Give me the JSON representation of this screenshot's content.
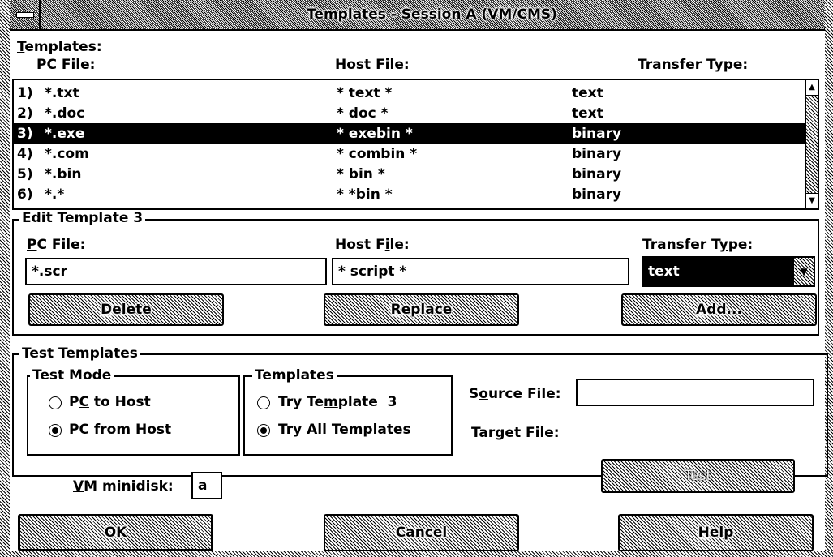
{
  "window": {
    "title": "Templates - Session A (VM/CMS)"
  },
  "templates_section": {
    "label": "Templates:",
    "col_pc": "PC File:",
    "col_host": "Host File:",
    "col_type": "Transfer Type:"
  },
  "template_rows": [
    {
      "num": "1)",
      "pc": "*.txt",
      "host": "* text *",
      "type": "text"
    },
    {
      "num": "2)",
      "pc": "*.doc",
      "host": "* doc *",
      "type": "text"
    },
    {
      "num": "3)",
      "pc": "*.exe",
      "host": "* exebin *",
      "type": "binary"
    },
    {
      "num": "4)",
      "pc": "*.com",
      "host": "* combin *",
      "type": "binary"
    },
    {
      "num": "5)",
      "pc": "*.bin",
      "host": "* bin *",
      "type": "binary"
    },
    {
      "num": "6)",
      "pc": "*.*",
      "host": "* *bin *",
      "type": "binary"
    }
  ],
  "selected_row_index": 2,
  "edit": {
    "label": "Edit Template  3",
    "pc_label": "PC File:",
    "host_label": "Host File:",
    "type_label": "Transfer Type:",
    "pc_value": "*.scr",
    "host_value": "* script *",
    "type_value": "text",
    "delete": "Delete",
    "replace": "Replace",
    "add": "Add..."
  },
  "test": {
    "label": "Test Templates",
    "mode_label": "Test Mode",
    "pc_to_host": "PC to Host",
    "pc_from_host": "PC from Host",
    "templates_label": "Templates",
    "try_template": "Try Template  3",
    "try_all": "Try All Templates",
    "source_label": "Source File:",
    "source_value": "",
    "target_label": "Target File:",
    "vm_label": "VM minidisk:",
    "vm_value": "a",
    "test_button": "Test"
  },
  "buttons": {
    "ok": "OK",
    "cancel": "Cancel",
    "help": "Help"
  }
}
